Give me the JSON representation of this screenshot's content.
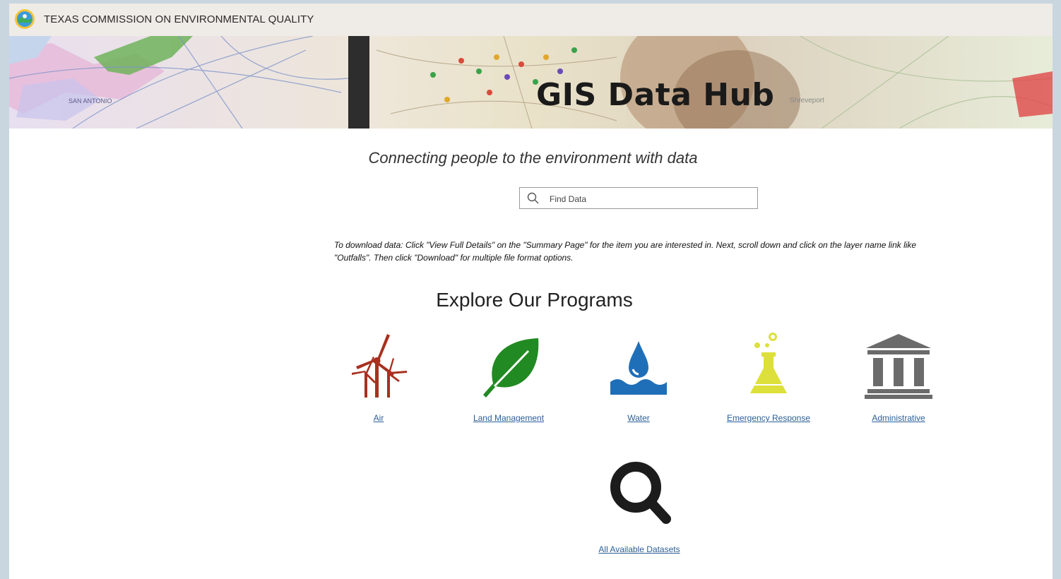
{
  "header": {
    "agency_name": "TEXAS COMMISSION ON ENVIRONMENTAL QUALITY"
  },
  "banner": {
    "title": "GIS Data Hub",
    "map_labels": [
      "SAN ANTONIO",
      "Shreveport"
    ]
  },
  "tagline": "Connecting people to the environment with data",
  "search": {
    "placeholder": "Find Data"
  },
  "instructions": {
    "line1": "To download data: Click \"View Full Details\" on the \"Summary Page\" for the item you are interested in.  Next, scroll down and click on the layer name link like",
    "line2": "\"Outfalls\".  Then click \"Download\" for multiple file format options."
  },
  "programs": {
    "title": "Explore Our Programs",
    "items": [
      {
        "label": "Air",
        "icon": "wind-turbine-icon",
        "color": "#a8301f"
      },
      {
        "label": "Land Management",
        "icon": "leaf-icon",
        "color": "#218a22"
      },
      {
        "label": "Water",
        "icon": "water-drop-icon",
        "color": "#1f6fb8"
      },
      {
        "label": "Emergency Response",
        "icon": "flask-icon",
        "color": "#dde03a"
      },
      {
        "label": "Administrative",
        "icon": "building-icon",
        "color": "#6b6b6b"
      }
    ],
    "all": {
      "label": "All Available Datasets",
      "icon": "search-icon",
      "color": "#1c1c1c"
    }
  },
  "colors": {
    "link": "#2c5f96",
    "header_bg": "#efebe7",
    "outer_bg": "#c9d6e0"
  }
}
